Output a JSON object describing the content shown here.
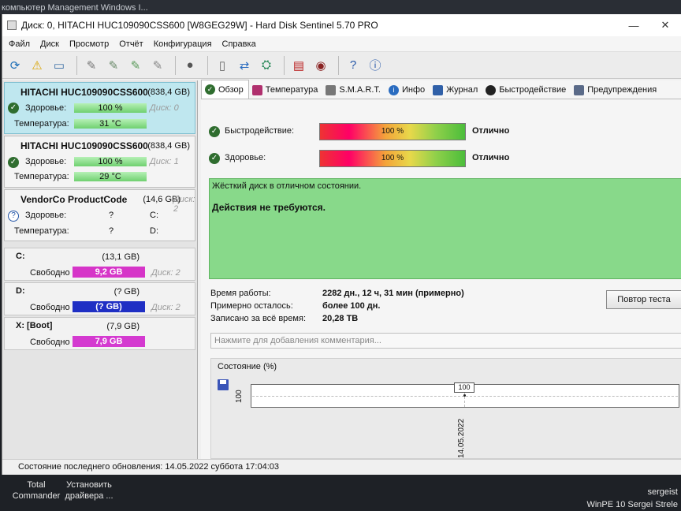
{
  "bg_top": "компьютер    Management    Windows I...",
  "window": {
    "title": "Диск: 0, HITACHI HUC109090CSS600 [W8GEG29W]  -  Hard Disk Sentinel 5.70 PRO",
    "minimize": "—",
    "close": "✕"
  },
  "menu": [
    "Файл",
    "Диск",
    "Просмотр",
    "Отчёт",
    "Конфигурация",
    "Справка"
  ],
  "toolbar_icons": [
    "refresh-icon",
    "warning-icon",
    "monitor-icon",
    "disk-test-icon",
    "disk-test2-icon",
    "disk-test3-icon",
    "disk-test4-icon",
    "blob-icon",
    "file-icon",
    "sync-icon",
    "network-icon",
    "report-icon",
    "settings-icon",
    "help-icon",
    "info-icon"
  ],
  "disks": [
    {
      "name": "HITACHI HUC109090CSS600",
      "capacity": "(838,4 GB)",
      "health_label": "Здоровье:",
      "health": "100 %",
      "disk_no": "Диск: 0",
      "temp_label": "Температура:",
      "temp": "31 °C"
    },
    {
      "name": "HITACHI HUC109090CSS600",
      "capacity": "(838,4 GB)",
      "health_label": "Здоровье:",
      "health": "100 %",
      "disk_no": "Диск: 1",
      "temp_label": "Температура:",
      "temp": "29 °C"
    },
    {
      "name": "VendorCo ProductCode",
      "capacity": "(14,6 GB)",
      "disk_no": "Диск: 2",
      "health_label": "Здоровье:",
      "health": "?",
      "drive": "C:",
      "temp_label": "Температура:",
      "temp": "?",
      "drive2": "D:"
    }
  ],
  "volumes": [
    {
      "name": "C:",
      "size": "(13,1 GB)",
      "free_label": "Свободно",
      "free": "9,2 GB",
      "disk": "Диск: 2",
      "color": "#d635c8"
    },
    {
      "name": "D:",
      "size": "(? GB)",
      "free_label": "Свободно",
      "free": "(? GB)",
      "disk": "Диск: 2",
      "color": "#1f2fc4"
    },
    {
      "name": "X: [Boot]",
      "size": "(7,9 GB)",
      "free_label": "Свободно",
      "free": "7,9 GB",
      "disk": "",
      "color": "#d43ad0"
    }
  ],
  "tabs": [
    "Обзор",
    "Температура",
    "S.M.A.R.T.",
    "Инфо",
    "Журнал",
    "Быстродействие",
    "Предупреждения"
  ],
  "overview": {
    "perf_label": "Быстродействие:",
    "perf_value": "100 %",
    "perf_result": "Отлично",
    "perf_level": 100,
    "health_label": "Здоровье:",
    "health_value": "100 %",
    "health_result": "Отлично",
    "health_level": 100,
    "status_line1": "Жёсткий диск в отличном состоянии.",
    "status_line2": "Действия не требуются.",
    "uptime_label": "Время работы:",
    "uptime_value": "2282 дн., 12 ч, 31 мин (примерно)",
    "remain_label": "Примерно осталось:",
    "remain_value": "более 100 дн.",
    "written_label": "Записано за всё время:",
    "written_value": "20,28 TB",
    "repeat_button": "Повтор теста",
    "comment_placeholder": "Нажмите для добавления комментария..."
  },
  "chart_data": {
    "type": "line",
    "title": "Состояние (%)",
    "x": [
      "14.05.2022"
    ],
    "series": [
      {
        "values": [
          100
        ]
      }
    ],
    "ytick": "100",
    "data_label": "100"
  },
  "statusbar": "Состояние последнего обновления: 14.05.2022 суббота 17:04:03",
  "desktop": {
    "icon1_line1": "Total",
    "icon1_line2": "Commander",
    "icon2_line1": "Установить",
    "icon2_line2": "драйвера ...",
    "wm_line1": "sergeist",
    "wm_line2": "WinPE 10 Sergei Strele"
  }
}
